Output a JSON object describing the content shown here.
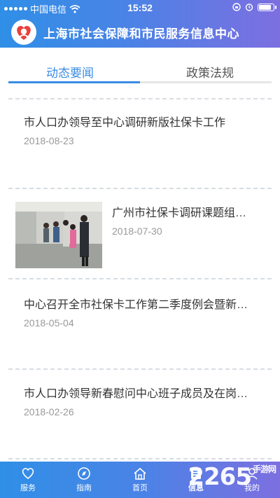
{
  "status_bar": {
    "carrier": "中国电信",
    "time": "15:52",
    "battery_level": 0.9
  },
  "header": {
    "title": "上海市社会保障和市民服务信息中心"
  },
  "tabs": [
    {
      "label": "动态要闻",
      "active": true
    },
    {
      "label": "政策法规",
      "active": false
    }
  ],
  "news": [
    {
      "title": "市人口办领导至中心调研新版社保卡工作",
      "date": "2018-08-23",
      "has_image": false
    },
    {
      "title": "广州市社保卡调研课题组…",
      "date": "2018-07-30",
      "has_image": true
    },
    {
      "title": "中心召开全市社保卡工作第二季度例会暨新…",
      "date": "2018-05-04",
      "has_image": false
    },
    {
      "title": "市人口办领导新春慰问中心班子成员及在岗…",
      "date": "2018-02-26",
      "has_image": false
    }
  ],
  "bottom_nav": [
    {
      "label": "服务",
      "icon": "heart-icon",
      "active": false
    },
    {
      "label": "指南",
      "icon": "compass-icon",
      "active": false
    },
    {
      "label": "首页",
      "icon": "home-icon",
      "active": false
    },
    {
      "label": "信息",
      "icon": "document-icon",
      "active": true
    },
    {
      "label": "我的",
      "icon": "user-icon",
      "active": false
    }
  ],
  "watermark": {
    "text": "2265",
    "sub": "手游网"
  },
  "colors": {
    "accent": "#3a8be3",
    "bar_start": "#2f8fe6",
    "bar_end": "#7d6fe0"
  }
}
